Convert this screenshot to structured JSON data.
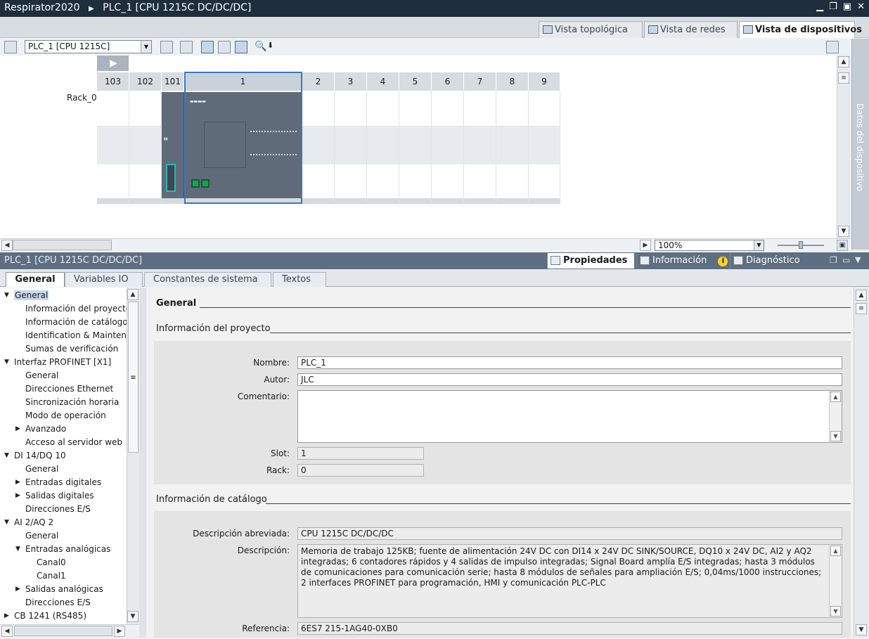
{
  "window": {
    "project": "Respirator2020",
    "device": "PLC_1 [CPU 1215C DC/DC/DC]",
    "controls": [
      "minimize-icon",
      "restore-icon",
      "maximize-icon",
      "close-icon"
    ]
  },
  "view_tabs": [
    {
      "label": "Vista topológica",
      "icon": "topology-icon"
    },
    {
      "label": "Vista de redes",
      "icon": "network-icon"
    },
    {
      "label": "Vista de dispositivos",
      "icon": "device-icon",
      "active": true
    }
  ],
  "device_toolbar": {
    "device_select": "PLC_1 [CPU 1215C]"
  },
  "rack": {
    "label": "Rack_0",
    "slots": [
      "103",
      "102",
      "101",
      "1",
      "2",
      "3",
      "4",
      "5",
      "6",
      "7",
      "8",
      "9"
    ]
  },
  "zoom": {
    "value": "100%"
  },
  "side_panel": {
    "label": "Datos del dispositivo"
  },
  "properties": {
    "title": "PLC_1 [CPU 1215C DC/DC/DC]",
    "tabs": [
      {
        "label": "Propiedades",
        "icon": "properties-icon",
        "active": true
      },
      {
        "label": "Información",
        "icon": "info-icon",
        "badge": "i"
      },
      {
        "label": "Diagnóstico",
        "icon": "diagnostics-icon"
      }
    ],
    "subtabs": [
      "General",
      "Variables IO",
      "Constantes de sistema",
      "Textos"
    ]
  },
  "tree": [
    {
      "label": "General",
      "level": 0,
      "arrow": "down",
      "selected": true
    },
    {
      "label": "Información del proyecto",
      "level": 1
    },
    {
      "label": "Información de catálogo",
      "level": 1
    },
    {
      "label": "Identification & Mainten...",
      "level": 1
    },
    {
      "label": "Sumas de verificación",
      "level": 1
    },
    {
      "label": "Interfaz PROFINET [X1]",
      "level": 0,
      "arrow": "down"
    },
    {
      "label": "General",
      "level": 1
    },
    {
      "label": "Direcciones Ethernet",
      "level": 1
    },
    {
      "label": "Sincronización horaria",
      "level": 1
    },
    {
      "label": "Modo de operación",
      "level": 1
    },
    {
      "label": "Avanzado",
      "level": 1,
      "arrow": "right"
    },
    {
      "label": "Acceso al servidor web",
      "level": 1
    },
    {
      "label": "DI 14/DQ 10",
      "level": 0,
      "arrow": "down"
    },
    {
      "label": "General",
      "level": 1
    },
    {
      "label": "Entradas digitales",
      "level": 1,
      "arrow": "right"
    },
    {
      "label": "Salidas digitales",
      "level": 1,
      "arrow": "right"
    },
    {
      "label": "Direcciones E/S",
      "level": 1
    },
    {
      "label": "AI 2/AQ 2",
      "level": 0,
      "arrow": "down"
    },
    {
      "label": "General",
      "level": 1
    },
    {
      "label": "Entradas analógicas",
      "level": 1,
      "arrow": "down"
    },
    {
      "label": "Canal0",
      "level": 2
    },
    {
      "label": "Canal1",
      "level": 2
    },
    {
      "label": "Salidas analógicas",
      "level": 1,
      "arrow": "right"
    },
    {
      "label": "Direcciones E/S",
      "level": 1
    },
    {
      "label": "CB 1241 (RS485)",
      "level": 0,
      "arrow": "right"
    }
  ],
  "content": {
    "general_header": "General",
    "project_info": {
      "header": "Información del proyecto",
      "name_label": "Nombre:",
      "name_value": "PLC_1",
      "author_label": "Autor:",
      "author_value": "JLC",
      "comment_label": "Comentario:",
      "comment_value": "",
      "slot_label": "Slot:",
      "slot_value": "1",
      "rack_label": "Rack:",
      "rack_value": "0"
    },
    "catalog_info": {
      "header": "Información de catálogo",
      "short_desc_label": "Descripción abreviada:",
      "short_desc_value": "CPU 1215C DC/DC/DC",
      "desc_label": "Descripción:",
      "desc_value": "Memoria de trabajo 125KB; fuente de alimentación 24V DC con DI14 x 24V DC SINK/SOURCE, DQ10 x 24V DC, AI2 y AQ2 integradas; 6 contadores rápidos y 4 salidas de impulso integradas; Signal Board amplía E/S integradas; hasta 3 módulos de comunicaciones para comunicación serie; hasta 8 módulos de señales para ampliación E/S; 0,04ms/1000 instrucciones; 2 interfaces PROFINET para programación, HMI y comunicación PLC-PLC",
      "ref_label": "Referencia:",
      "ref_value": "6ES7 215-1AG40-0XB0"
    }
  }
}
